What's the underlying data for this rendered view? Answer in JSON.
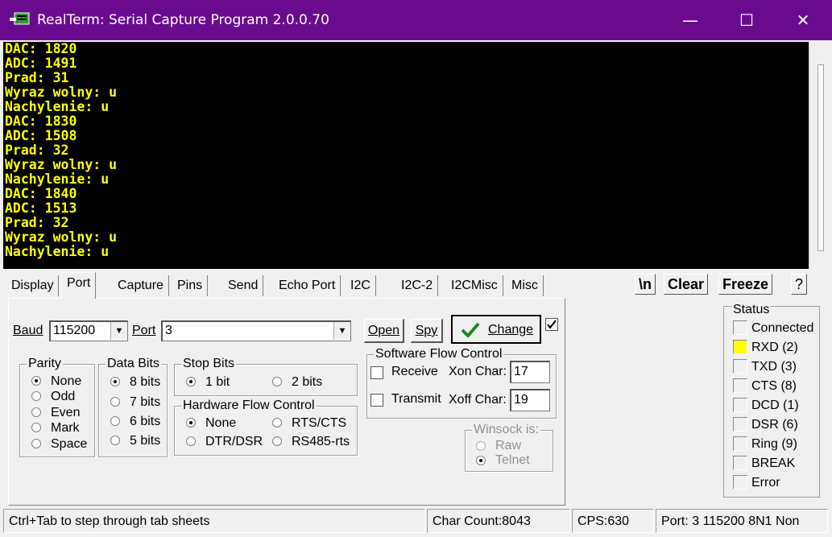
{
  "window": {
    "title": "RealTerm: Serial Capture Program 2.0.0.70",
    "minimize": "—",
    "maximize": "☐",
    "close": "✕",
    "titlebar_color": "#6a0b8f"
  },
  "terminal": {
    "text_color": "#ffff00",
    "lines": [
      "DAC: 1820",
      "ADC: 1491",
      "Prad: 31",
      "Wyraz wolny: u",
      "Nachylenie: u",
      "DAC: 1830",
      "ADC: 1508",
      "Prad: 32",
      "Wyraz wolny: u",
      "Nachylenie: u",
      "DAC: 1840",
      "ADC: 1513",
      "Prad: 32",
      "Wyraz wolny: u",
      "Nachylenie: u"
    ]
  },
  "tabs": [
    "Display",
    "Port",
    "Capture",
    "Pins",
    "Send",
    "Echo Port",
    "I2C",
    "I2C-2",
    "I2CMisc",
    "Misc"
  ],
  "active_tab": "Port",
  "toolbar": {
    "newline": "\\n",
    "clear": "Clear",
    "freeze": "Freeze",
    "help": "?"
  },
  "port": {
    "baud_label": "Baud",
    "baud_value": "115200",
    "port_label": "Port",
    "port_value": "3",
    "open_label": "Open",
    "spy_label": "Spy",
    "change_label": "Change",
    "change_checked": true,
    "parity": {
      "title": "Parity",
      "options": [
        "None",
        "Odd",
        "Even",
        "Mark",
        "Space"
      ],
      "selected": "None"
    },
    "data_bits": {
      "title": "Data Bits",
      "options": [
        "8 bits",
        "7 bits",
        "6 bits",
        "5 bits"
      ],
      "selected": "8 bits"
    },
    "stop_bits": {
      "title": "Stop Bits",
      "options": [
        "1 bit",
        "2 bits"
      ],
      "selected": "1 bit"
    },
    "hw_flow": {
      "title": "Hardware Flow Control",
      "options": [
        "None",
        "RTS/CTS",
        "DTR/DSR",
        "RS485-rts"
      ],
      "selected": "None"
    },
    "sw_flow": {
      "title": "Software Flow Control",
      "receive_label": "Receive",
      "transmit_label": "Transmit",
      "xon_label": "Xon Char:",
      "xon_value": "17",
      "xoff_label": "Xoff Char:",
      "xoff_value": "19"
    },
    "winsock": {
      "title": "Winsock is:",
      "options": [
        "Raw",
        "Telnet"
      ],
      "selected": "Telnet"
    }
  },
  "status": {
    "title": "Status",
    "items": [
      {
        "label": "Connected",
        "lit": false
      },
      {
        "label": "RXD (2)",
        "lit": true
      },
      {
        "label": "TXD (3)",
        "lit": false
      },
      {
        "label": "CTS (8)",
        "lit": false
      },
      {
        "label": "DCD (1)",
        "lit": false
      },
      {
        "label": "DSR (6)",
        "lit": false
      },
      {
        "label": "Ring (9)",
        "lit": false
      },
      {
        "label": "BREAK",
        "lit": false
      },
      {
        "label": "Error",
        "lit": false
      }
    ],
    "lit_color": "#ffff00"
  },
  "statusbar": {
    "hint": "Ctrl+Tab to step through tab sheets",
    "char_count": "Char Count:8043",
    "cps": "CPS:630",
    "port_info": "Port: 3 115200 8N1 Non"
  }
}
